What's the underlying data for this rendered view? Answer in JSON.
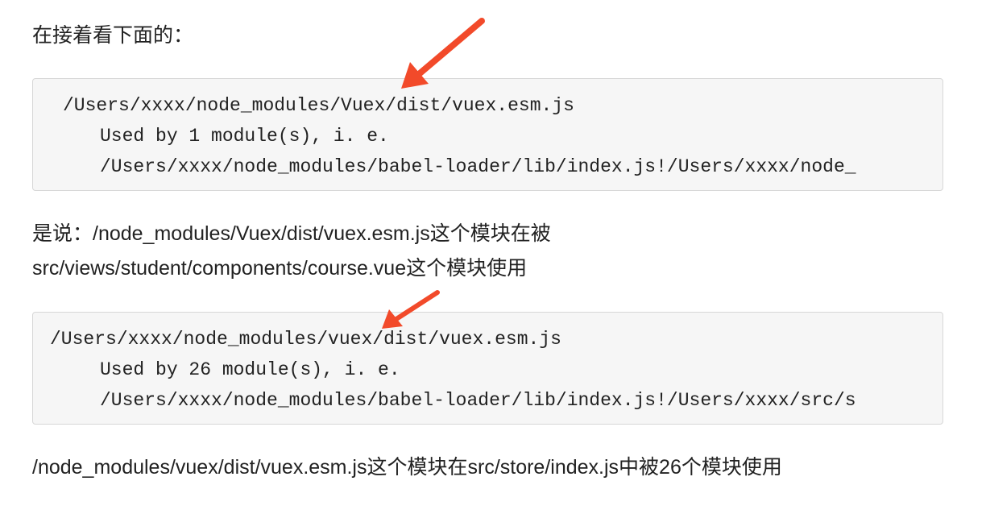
{
  "intro": "在接着看下面的：",
  "block1": {
    "line1": "/Users/xxxx/node_modules/Vuex/dist/vuex.esm.js",
    "line2": "Used by 1 module(s), i. e.",
    "line3": "/Users/xxxx/node_modules/babel-loader/lib/index.js!/Users/xxxx/node_"
  },
  "explain1": {
    "line1": "是说：/node_modules/Vuex/dist/vuex.esm.js这个模块在被",
    "line2": "src/views/student/components/course.vue这个模块使用"
  },
  "block2": {
    "line1": "/Users/xxxx/node_modules/vuex/dist/vuex.esm.js",
    "line2": "Used by 26 module(s), i. e.",
    "line3": "/Users/xxxx/node_modules/babel-loader/lib/index.js!/Users/xxxx/src/s"
  },
  "explain2": "/node_modules/vuex/dist/vuex.esm.js这个模块在src/store/index.js中被26个模块使用",
  "colors": {
    "arrow": "#f24a2a",
    "code_bg": "#f6f6f6",
    "code_border": "#d7d7d7"
  }
}
